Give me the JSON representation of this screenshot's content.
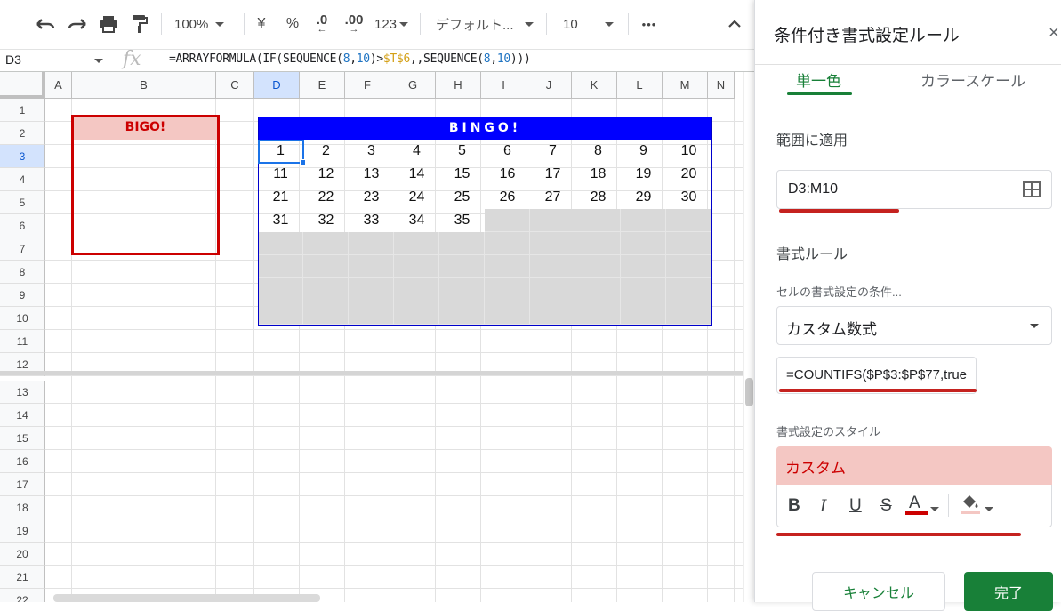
{
  "toolbar": {
    "zoom": "100%",
    "currency": "¥",
    "percent": "%",
    "dec_decrease": ".0",
    "dec_increase": ".00",
    "number_format": "123",
    "font": "デフォルト...",
    "font_size": "10",
    "more": "•••"
  },
  "formula_bar": {
    "name_box": "D3",
    "fx": "fx",
    "formula_parts": [
      "=ARRAYFORMULA(IF(SEQUENCE(",
      "8",
      ",",
      "10",
      ")>",
      "$T$6",
      ",,SEQUENCE(",
      "8",
      ",",
      "10",
      ")))"
    ]
  },
  "grid": {
    "columns": [
      "A",
      "B",
      "C",
      "D",
      "E",
      "F",
      "G",
      "H",
      "I",
      "J",
      "K",
      "L",
      "M",
      "N"
    ],
    "rows": [
      "1",
      "2",
      "3",
      "4",
      "5",
      "6",
      "7",
      "8",
      "9",
      "10",
      "11",
      "12",
      "13",
      "14",
      "15",
      "16",
      "17",
      "18",
      "19",
      "20",
      "21",
      "22"
    ],
    "selected_cell": "D3",
    "bigo_title": "BIGO!",
    "bingo_title": "BINGO!",
    "bingo_numbers": [
      [
        "1",
        "2",
        "3",
        "4",
        "5",
        "6",
        "7",
        "8",
        "9",
        "10"
      ],
      [
        "11",
        "12",
        "13",
        "14",
        "15",
        "16",
        "17",
        "18",
        "19",
        "20"
      ],
      [
        "21",
        "22",
        "23",
        "24",
        "25",
        "26",
        "27",
        "28",
        "29",
        "30"
      ],
      [
        "31",
        "32",
        "33",
        "34",
        "35"
      ]
    ]
  },
  "panel": {
    "title": "条件付き書式設定ルール",
    "close": "×",
    "tab_solid": "単一色",
    "tab_scale": "カラースケール",
    "range_label": "範囲に適用",
    "range_value": "D3:M10",
    "rules_label": "書式ルール",
    "condition_label": "セルの書式設定の条件...",
    "condition_value": "カスタム数式",
    "formula_value": "=COUNTIFS($P$3:$P$77,true",
    "style_label": "書式設定のスタイル",
    "style_preview": "カスタム",
    "style_tools": {
      "bold": "B",
      "italic": "I",
      "underline": "U",
      "strike": "S",
      "text_color": "A"
    },
    "cancel": "キャンセル",
    "done": "完了"
  },
  "colors": {
    "accent_green": "#188038",
    "bingo_blue": "#0000ff",
    "custom_red": "#cc0000",
    "custom_fill": "#f4c7c3",
    "select_blue": "#1a73e8"
  }
}
